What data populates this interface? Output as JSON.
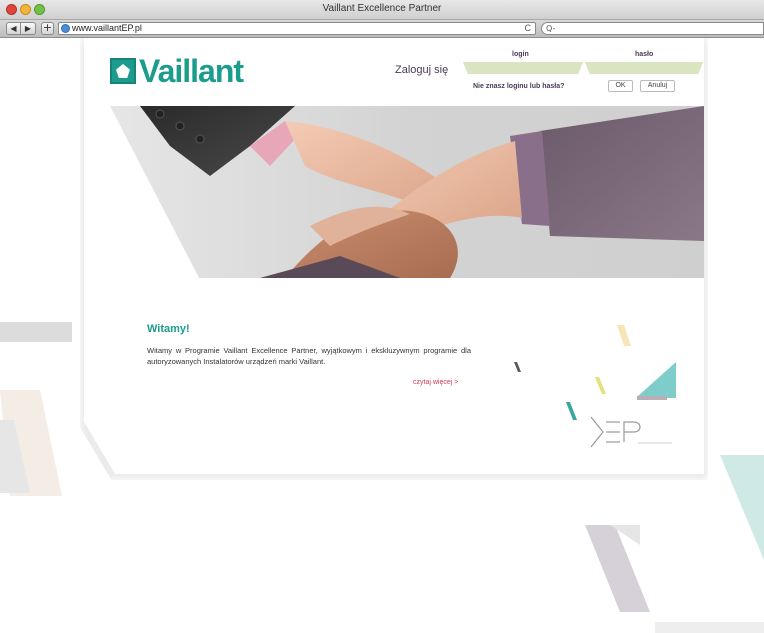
{
  "window": {
    "title": "Vaillant Excellence Partner"
  },
  "browser": {
    "url": "www.vaillantEP.pl",
    "search_placeholder": "Q-",
    "back_label": "◀",
    "forward_label": "▶",
    "add_label": "+",
    "reload_label": "C"
  },
  "header": {
    "logo_text": "Vaillant",
    "login_title": "Zaloguj się",
    "login_label": "login",
    "password_label": "hasło",
    "forgot_text": "Nie znasz loginu lub hasła?",
    "ok_label": "OK",
    "cancel_label": "Anuluj"
  },
  "main": {
    "welcome_title": "Witamy!",
    "welcome_text": "Witamy w Programie Vaillant Excellence Partner, wyjątkowym i ekskluzywnym programie dla autoryzowanych Instalatorów urządzeń marki Vaillant.",
    "read_more": "czytaj więcej >"
  },
  "colors": {
    "brand": "#1b9c8d",
    "accent": "#d13b5a",
    "input_bg": "#d9e4c0",
    "text_dark": "#4a3a55"
  }
}
